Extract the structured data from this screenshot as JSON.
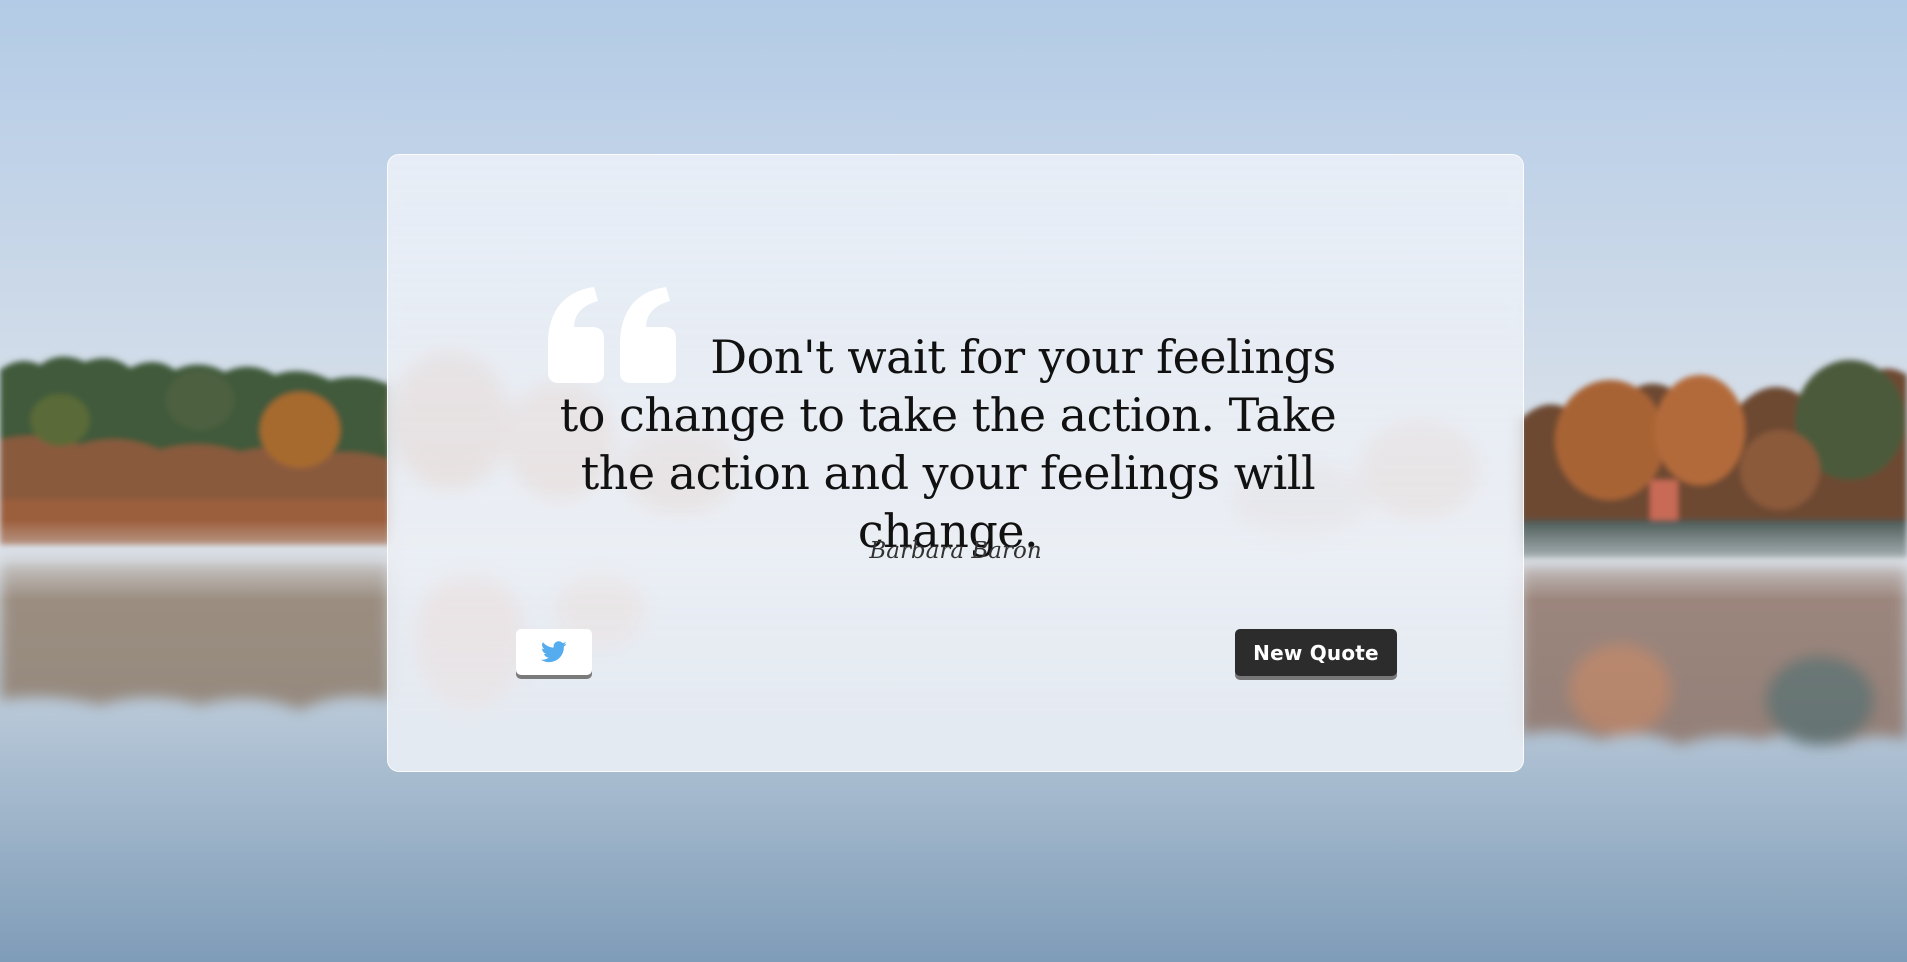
{
  "quote": {
    "text": "Don't wait for your feelings to change to take the action. Take the action and your feelings will change.",
    "author": "Barbara Baron"
  },
  "actions": {
    "tweet_icon": "twitter-bird-icon",
    "new_quote_label": "New Quote"
  },
  "colors": {
    "card_border": "#ffffff",
    "button_dark": "#2c2c2c",
    "twitter_blue": "#55acee",
    "quote_mark": "#ffffff"
  }
}
